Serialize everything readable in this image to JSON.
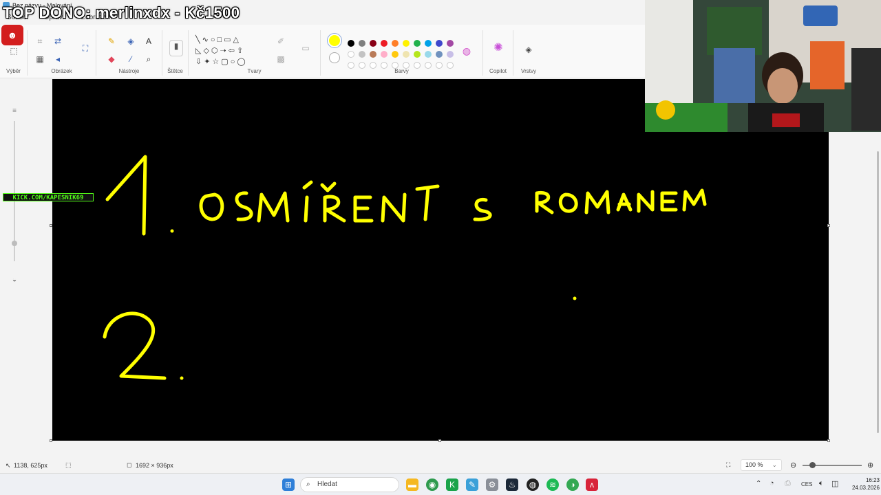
{
  "window": {
    "title": "Bez názvu - Malování"
  },
  "menu": [
    "Soubor",
    "Upravit",
    "Zobrazení"
  ],
  "ribbon": {
    "groups": {
      "selection": "Výběr",
      "image": "Obrázek",
      "tools": "Nástroje",
      "brushes": "Štětce",
      "shapes": "Tvary",
      "colors": "Barvy",
      "copilot": "Copilot",
      "layers": "Vrstvy"
    },
    "selected_color": "#ffff00",
    "palette_row1": [
      "#000000",
      "#7f7f7f",
      "#880015",
      "#ed1c24",
      "#ff7f27",
      "#fff200",
      "#22b14c",
      "#00a2e8",
      "#3f48cc",
      "#a349a4"
    ],
    "palette_row2": [
      "#ffffff",
      "#c3c3c3",
      "#b97a57",
      "#ffaec9",
      "#ffc90e",
      "#efe4b0",
      "#b5e61d",
      "#99d9ea",
      "#7092be",
      "#c8bfe7"
    ]
  },
  "canvas": {
    "background": "#000000",
    "ink_color": "#ffff00",
    "lines": [
      {
        "number": "1.",
        "text": "OSMÍŘENÍ S ROMANEM"
      },
      {
        "number": "2.",
        "text": ""
      }
    ]
  },
  "overlay": {
    "donation": "TOP DONO: merlinxdx - Kč1500",
    "channel": "KICK.COM/KAPESNIK69"
  },
  "statusbar": {
    "cursor_pos": "1138, 625px",
    "canvas_size": "1692 × 936px",
    "zoom": "100 %"
  },
  "taskbar": {
    "search_placeholder": "Hledat",
    "language": "CES",
    "time": "16:23",
    "date": "24.03.2026"
  }
}
